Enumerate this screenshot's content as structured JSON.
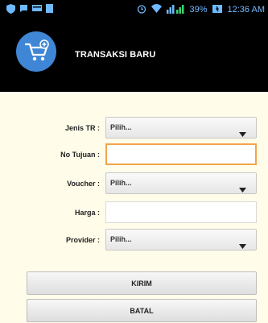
{
  "statusbar": {
    "battery": "39%",
    "time": "12:36 AM",
    "icons": [
      "shield-icon",
      "chat-icon",
      "card-icon",
      "square-icon",
      "alarm-icon",
      "wifi-icon",
      "signal-icon",
      "battery-icon"
    ]
  },
  "appbar": {
    "title": "TRANSAKSI BARU",
    "logo_icon": "cart-add-icon",
    "logo_color": "#3f86d6"
  },
  "form": {
    "jenis_tr": {
      "label": "Jenis TR :",
      "value": "Pilih..."
    },
    "no_tujuan": {
      "label": "No Tujuan :",
      "value": "",
      "placeholder": ""
    },
    "voucher": {
      "label": "Voucher :",
      "value": "Pilih..."
    },
    "harga": {
      "label": "Harga :",
      "value": "",
      "placeholder": ""
    },
    "provider": {
      "label": "Provider :",
      "value": "Pilih..."
    }
  },
  "buttons": {
    "kirim": "KIRIM",
    "batal": "BATAL"
  },
  "colors": {
    "background": "#fffce9",
    "focus_border": "#f2a54b"
  }
}
